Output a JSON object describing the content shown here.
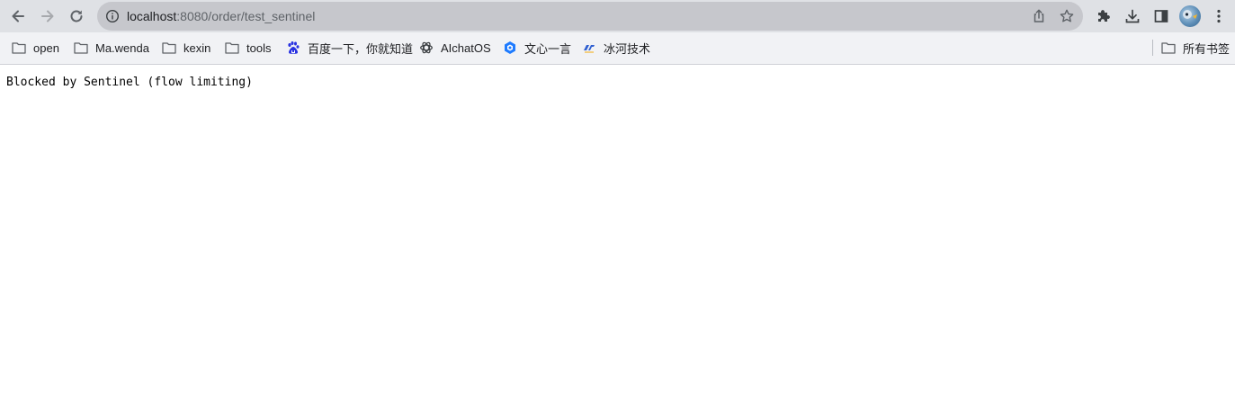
{
  "browser": {
    "address_bar": {
      "url_host": "localhost",
      "url_rest": ":8080/order/test_sentinel"
    },
    "bookmarks": [
      {
        "label": "open",
        "icon": "folder-icon"
      },
      {
        "label": "Ma.wenda",
        "icon": "folder-icon"
      },
      {
        "label": "kexin",
        "icon": "folder-icon"
      },
      {
        "label": "tools",
        "icon": "folder-icon"
      },
      {
        "label": "百度一下，你就知道",
        "icon": "baidu-icon"
      },
      {
        "label": "AIchatOS",
        "icon": "openai-icon"
      },
      {
        "label": "文心一言",
        "icon": "wenxin-icon"
      },
      {
        "label": "冰河技术",
        "icon": "binghe-icon"
      }
    ],
    "all_bookmarks": {
      "label": "所有书签",
      "icon": "folder-icon"
    }
  },
  "page": {
    "message": "Blocked by Sentinel (flow limiting)"
  },
  "colors": {
    "toolbar_bg": "#dfe1e5",
    "omnibox_bg": "#c6c7cc",
    "bookmark_bar_bg": "#f1f2f5",
    "icon_gray": "#5f6368",
    "baidu_blue": "#2932e1",
    "wenxin_blue": "#1e7bff"
  }
}
